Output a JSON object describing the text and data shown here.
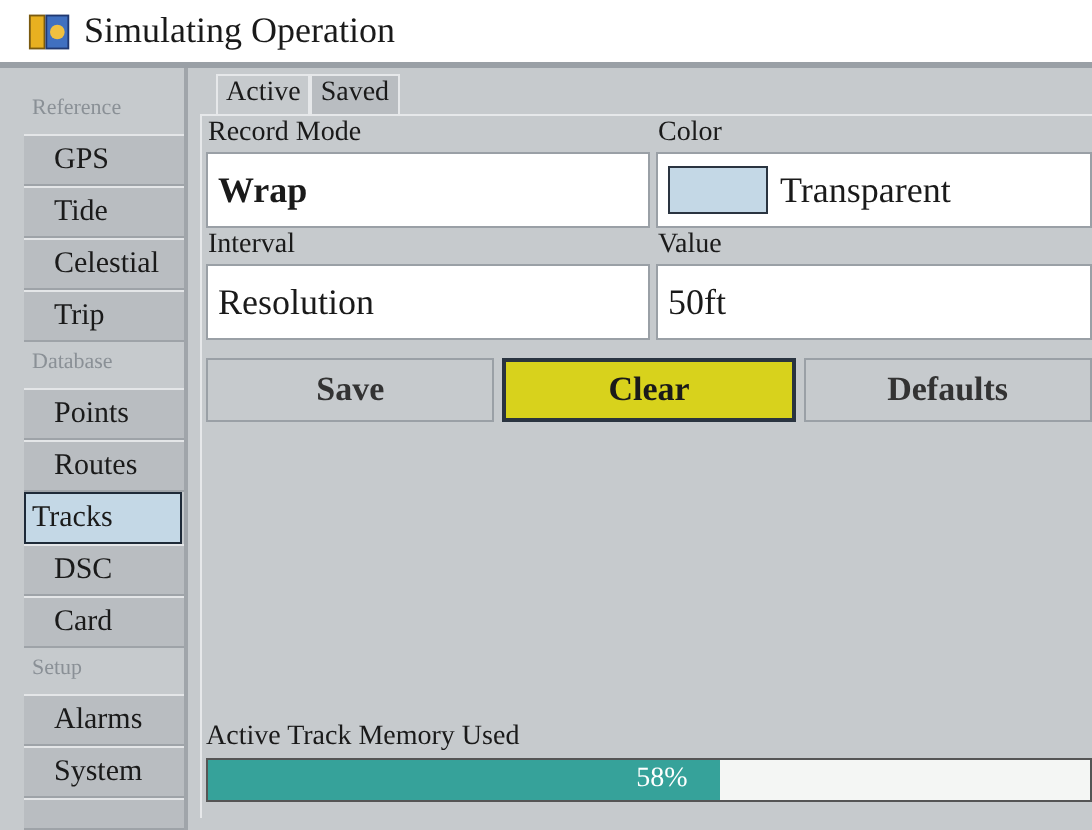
{
  "window": {
    "title": "Simulating Operation"
  },
  "sidebar": {
    "items": [
      {
        "kind": "header",
        "label": "Reference"
      },
      {
        "kind": "item",
        "label": "GPS",
        "selected": false
      },
      {
        "kind": "item",
        "label": "Tide",
        "selected": false
      },
      {
        "kind": "item",
        "label": "Celestial",
        "selected": false
      },
      {
        "kind": "item",
        "label": "Trip",
        "selected": false
      },
      {
        "kind": "header",
        "label": "Database"
      },
      {
        "kind": "item",
        "label": "Points",
        "selected": false
      },
      {
        "kind": "item",
        "label": "Routes",
        "selected": false
      },
      {
        "kind": "item",
        "label": "Tracks",
        "selected": true
      },
      {
        "kind": "item",
        "label": "DSC",
        "selected": false
      },
      {
        "kind": "item",
        "label": "Card",
        "selected": false
      },
      {
        "kind": "header",
        "label": "Setup"
      },
      {
        "kind": "item",
        "label": "Alarms",
        "selected": false
      },
      {
        "kind": "item",
        "label": "System",
        "selected": false
      }
    ]
  },
  "tabs": [
    {
      "label": "Active",
      "selected": true
    },
    {
      "label": "Saved",
      "selected": false
    }
  ],
  "fields": [
    {
      "label": "Record Mode",
      "value": "Wrap",
      "kind": "bold"
    },
    {
      "label": "Color",
      "value": "Transparent",
      "kind": "swatch"
    },
    {
      "label": "Interval",
      "value": "Resolution",
      "kind": "plain"
    },
    {
      "label": "Value",
      "value": "50ft",
      "kind": "plain"
    }
  ],
  "buttons": [
    {
      "label": "Save",
      "selected": false
    },
    {
      "label": "Clear",
      "selected": true
    },
    {
      "label": "Defaults",
      "selected": false
    }
  ],
  "memory": {
    "label": "Active Track Memory Used",
    "level": 0.58,
    "reading": "58%"
  }
}
